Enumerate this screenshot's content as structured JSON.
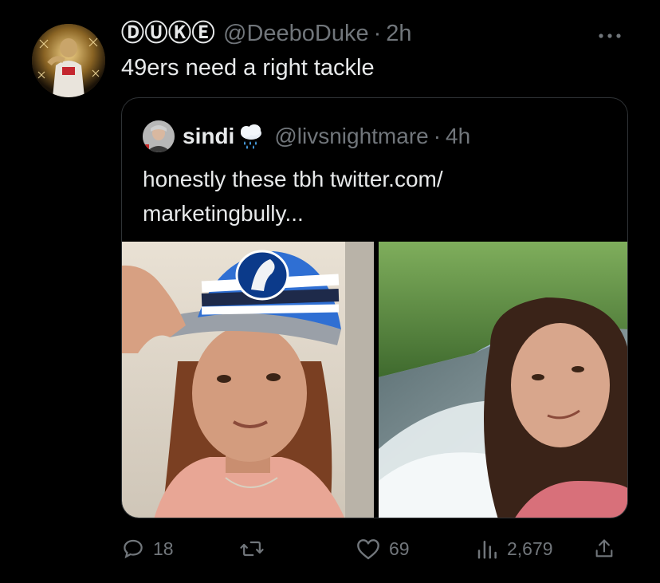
{
  "tweet": {
    "display_name": "ⒹⓊⓀⒺ",
    "handle": "@DeeboDuke",
    "separator": "·",
    "time": "2h",
    "text": "49ers need a right tackle",
    "more_label": "···"
  },
  "quote": {
    "name": "sindi",
    "emoji_icon": "cloud-rain-icon",
    "handle": "@livsnightmare",
    "separator": "·",
    "time": "4h",
    "text": "honestly these tbh twitter.com/ marketingbully..."
  },
  "actions": {
    "replies": "18",
    "retweets": "",
    "likes": "69",
    "views": "2,679"
  },
  "colors": {
    "background": "#000000",
    "primary_text": "#e7e9ea",
    "secondary_text": "#71767b",
    "border": "#2f3336"
  }
}
